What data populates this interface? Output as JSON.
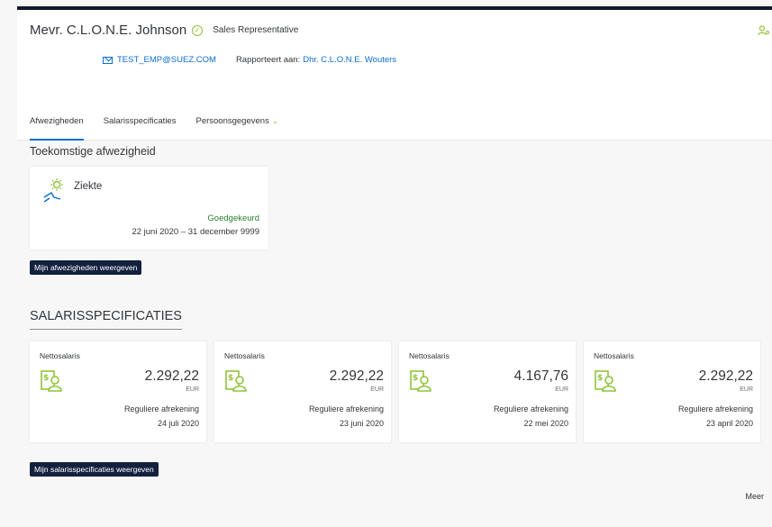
{
  "header": {
    "name": "Mevr. C.L.O.N.E. Johnson",
    "role": "Sales Representative",
    "email": "TEST_EMP@SUEZ.COM",
    "reports_label": "Rapporteert aan:",
    "manager": "Dhr. C.L.O.N.E. Wouters"
  },
  "tabs": [
    {
      "label": "Afwezigheden",
      "active": true
    },
    {
      "label": "Salarisspecificaties",
      "active": false
    },
    {
      "label": "Persoonsgegevens",
      "active": false,
      "dropdown": true
    }
  ],
  "absences": {
    "title": "Toekomstige afwezigheid",
    "card": {
      "type": "Ziekte",
      "status": "Goedgekeurd",
      "dates": "22 juni 2020 – 31 december 9999"
    },
    "button_label": "Mijn afwezigheden weergeven"
  },
  "payslips": {
    "title": "SALARISSPECIFICATIES",
    "cards": [
      {
        "label": "Nettosalaris",
        "amount": "2.292,22",
        "currency": "EUR",
        "type": "Reguliere afrekening",
        "date": "24 juli 2020"
      },
      {
        "label": "Nettosalaris",
        "amount": "2.292,22",
        "currency": "EUR",
        "type": "Reguliere afrekening",
        "date": "23 juni 2020"
      },
      {
        "label": "Nettosalaris",
        "amount": "4.167,76",
        "currency": "EUR",
        "type": "Reguliere afrekening",
        "date": "22 mei 2020"
      },
      {
        "label": "Nettosalaris",
        "amount": "2.292,22",
        "currency": "EUR",
        "type": "Reguliere afrekening",
        "date": "23 april 2020"
      }
    ],
    "button_label": "Mijn salarisspecificaties weergeven",
    "more_label": "Meer"
  },
  "colors": {
    "accent_green": "#8fc43a",
    "link_blue": "#0a6ed1",
    "dark_button": "#13213f",
    "approved_green": "#2b7c2b"
  },
  "icons": {
    "verified": "check-circle-icon",
    "contact": "person-key-icon",
    "mail": "mail-icon",
    "absence": "sun-lounger-icon",
    "payslip": "payslip-person-icon"
  }
}
